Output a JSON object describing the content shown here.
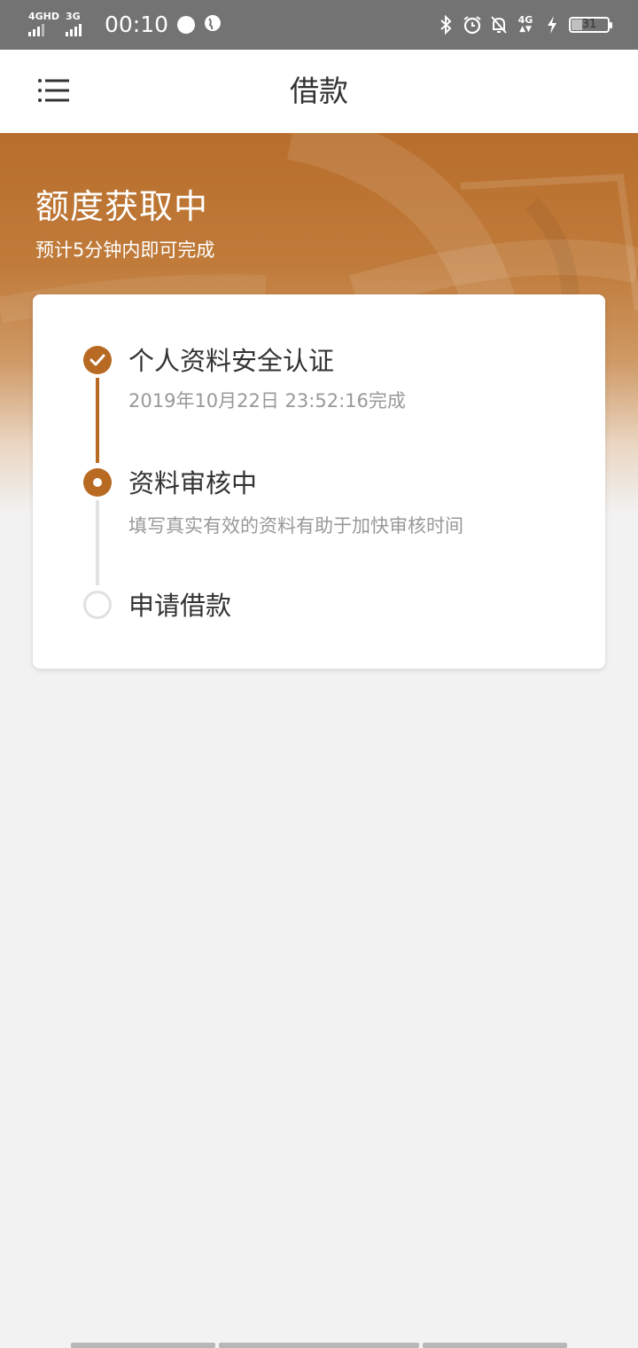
{
  "status_bar": {
    "signal1_label": "4GHD",
    "signal2_label": "3G",
    "time": "00:10",
    "network_label": "4G",
    "battery_level": "31",
    "battery_fraction": 0.31,
    "icons": [
      "app-icon",
      "globe-icon",
      "bluetooth-icon",
      "alarm-icon",
      "notifications-off-icon",
      "mobile-data-icon",
      "charging-icon",
      "battery-icon"
    ]
  },
  "header": {
    "title": "借款",
    "menu_icon": "hamburger-menu-icon"
  },
  "hero": {
    "title": "额度获取中",
    "subtitle": "预计5分钟内即可完成"
  },
  "steps": [
    {
      "title": "个人资料安全认证",
      "desc": "2019年10月22日 23:52:16完成",
      "status": "done"
    },
    {
      "title": "资料审核中",
      "desc": "填写真实有效的资料有助于加快审核时间",
      "status": "active"
    },
    {
      "title": "申请借款",
      "desc": "",
      "status": "pending"
    }
  ],
  "colors": {
    "accent": "#b86a23",
    "status_bar": "#737373",
    "background": "#f2f2f2",
    "muted_text": "#999999",
    "pending_ring": "#e0e0e0"
  }
}
